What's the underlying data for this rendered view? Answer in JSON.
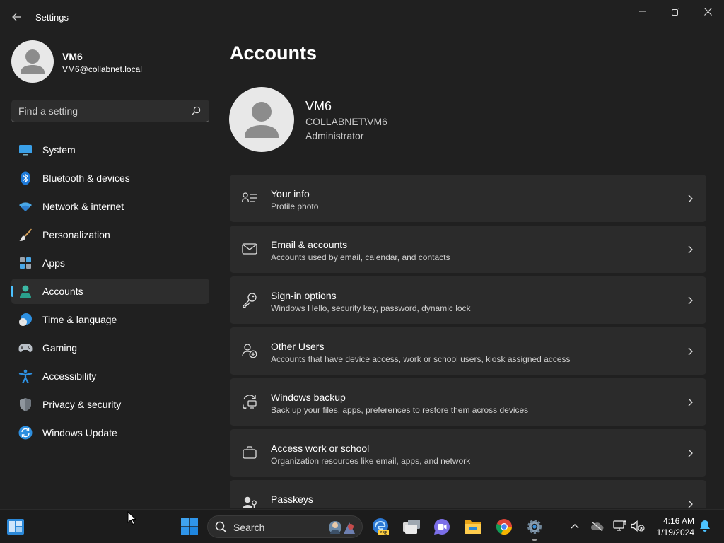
{
  "window": {
    "title": "Settings"
  },
  "profile": {
    "name": "VM6",
    "email": "VM6@collabnet.local"
  },
  "search": {
    "placeholder": "Find a setting"
  },
  "sidebar": {
    "items": [
      {
        "label": "System",
        "icon": "monitor-icon"
      },
      {
        "label": "Bluetooth & devices",
        "icon": "bluetooth-icon"
      },
      {
        "label": "Network & internet",
        "icon": "wifi-icon"
      },
      {
        "label": "Personalization",
        "icon": "brush-icon"
      },
      {
        "label": "Apps",
        "icon": "apps-icon"
      },
      {
        "label": "Accounts",
        "icon": "person-icon",
        "active": true
      },
      {
        "label": "Time & language",
        "icon": "globe-clock-icon"
      },
      {
        "label": "Gaming",
        "icon": "gamepad-icon"
      },
      {
        "label": "Accessibility",
        "icon": "accessibility-icon"
      },
      {
        "label": "Privacy & security",
        "icon": "shield-icon"
      },
      {
        "label": "Windows Update",
        "icon": "update-icon"
      }
    ]
  },
  "main": {
    "title": "Accounts",
    "account": {
      "name": "VM6",
      "domain": "COLLABNET\\VM6",
      "role": "Administrator"
    },
    "cards": [
      {
        "title": "Your info",
        "desc": "Profile photo",
        "icon": "person-details-icon"
      },
      {
        "title": "Email & accounts",
        "desc": "Accounts used by email, calendar, and contacts",
        "icon": "mail-icon"
      },
      {
        "title": "Sign-in options",
        "desc": "Windows Hello, security key, password, dynamic lock",
        "icon": "key-icon"
      },
      {
        "title": "Other Users",
        "desc": "Accounts that have device access, work or school users, kiosk assigned access",
        "icon": "person-add-icon"
      },
      {
        "title": "Windows backup",
        "desc": "Back up your files, apps, preferences to restore them across devices",
        "icon": "backup-icon"
      },
      {
        "title": "Access work or school",
        "desc": "Organization resources like email, apps, and network",
        "icon": "briefcase-icon"
      },
      {
        "title": "Passkeys",
        "desc": "",
        "icon": "passkey-icon"
      }
    ]
  },
  "taskbar": {
    "search_label": "Search",
    "time": "4:16 AM",
    "date": "1/19/2024"
  },
  "colors": {
    "accent": "#4cc2ff",
    "background": "#202020",
    "card": "#2b2b2b"
  }
}
